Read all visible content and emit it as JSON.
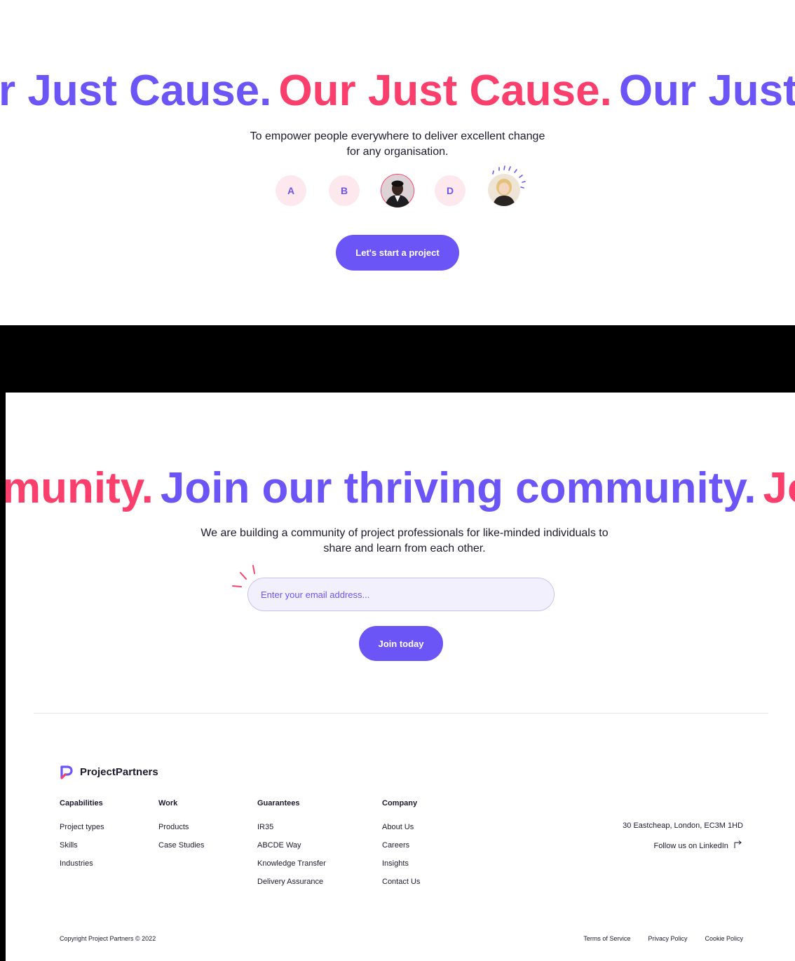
{
  "cause_section": {
    "marquee": [
      "r Just Cause.",
      "Our Just Cause.",
      "Our Just"
    ],
    "description_line1": "To empower people everywhere to deliver excellent change",
    "description_line2": "for any organisation.",
    "avatars": [
      "A",
      "B",
      "",
      "D",
      ""
    ],
    "cta_label": "Let's start a project"
  },
  "community_section": {
    "marquee": [
      "munity.",
      "Join our thriving community.",
      "Jo"
    ],
    "description_line1": "We are building a community of project professionals for like-minded individuals to",
    "description_line2": "share and learn from each other.",
    "email_placeholder": "Enter your email address...",
    "join_label": "Join today"
  },
  "footer": {
    "brand": "ProjectPartners",
    "columns": [
      {
        "title": "Capabilities",
        "links": [
          "Project types",
          "Skills",
          "Industries"
        ]
      },
      {
        "title": "Work",
        "links": [
          "Products",
          "Case Studies"
        ]
      },
      {
        "title": "Guarantees",
        "links": [
          "IR35",
          "ABCDE Way",
          "Knowledge Transfer",
          "Delivery Assurance"
        ]
      },
      {
        "title": "Company",
        "links": [
          "About Us",
          "Careers",
          "Insights",
          "Contact Us"
        ]
      }
    ],
    "address": "30 Eastcheap, London, EC3M 1HD",
    "linkedin": "Follow us on LinkedIn",
    "copyright": "Copyright Project Partners © 2022",
    "legal": [
      "Terms of Service",
      "Privacy Policy",
      "Cookie Policy"
    ]
  },
  "colors": {
    "primary": "#6c55f6",
    "accent": "#fb3f6c"
  }
}
